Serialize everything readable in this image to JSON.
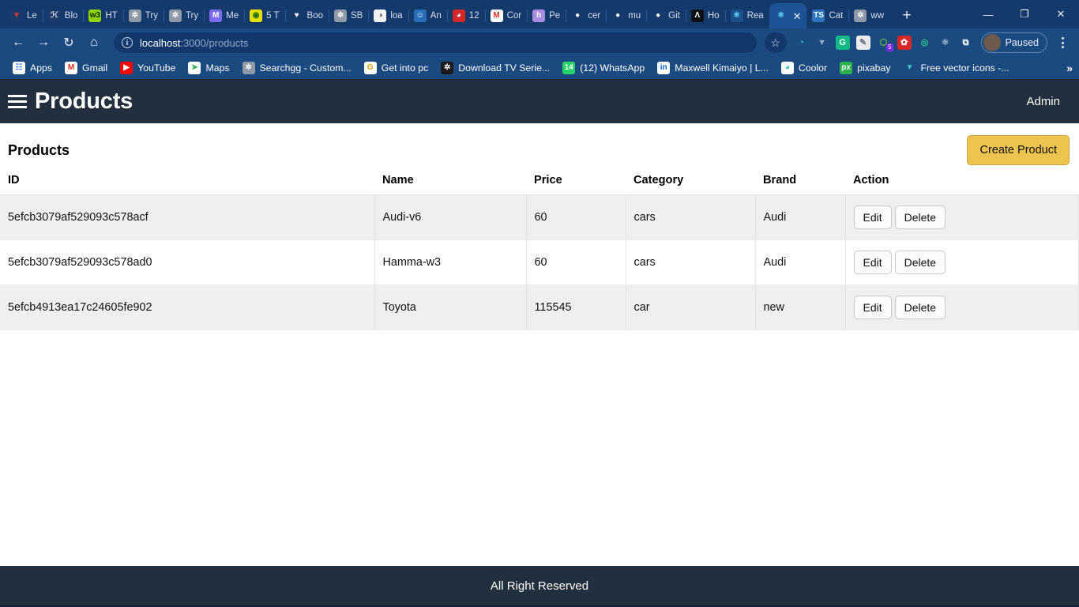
{
  "browser": {
    "tabs": [
      {
        "label": "Le",
        "icon": "vimeo-icon",
        "bg": "#1a3a6b",
        "fg": "#e3352b",
        "glyph": "▼",
        "active": false
      },
      {
        "label": "Blo",
        "icon": "handwriting-icon",
        "bg": "#1a3a6b",
        "fg": "#d8dde6",
        "glyph": "ℋ",
        "active": false
      },
      {
        "label": "HT",
        "icon": "w3schools-icon",
        "bg": "#8fd400",
        "fg": "#0b2a00",
        "glyph": "w3",
        "active": false
      },
      {
        "label": "Try",
        "icon": "globe-icon",
        "bg": "#8e9aa8",
        "fg": "#ffffff",
        "glyph": "✲",
        "active": false
      },
      {
        "label": "Try",
        "icon": "globe-icon",
        "bg": "#8e9aa8",
        "fg": "#ffffff",
        "glyph": "✲",
        "active": false
      },
      {
        "label": "Me",
        "icon": "messenger-icon",
        "bg": "#7b6cf0",
        "fg": "#ffffff",
        "glyph": "M",
        "active": false
      },
      {
        "label": "5 T",
        "icon": "frog-icon",
        "bg": "#e8e000",
        "fg": "#1b6f1b",
        "glyph": "◉",
        "active": false
      },
      {
        "label": "Boo",
        "icon": "heart-icon",
        "bg": "#14396b",
        "fg": "#ffffff",
        "glyph": "♥",
        "active": false
      },
      {
        "label": "SB",
        "icon": "globe-icon",
        "bg": "#8e9aa8",
        "fg": "#ffffff",
        "glyph": "✲",
        "active": false
      },
      {
        "label": "loa",
        "icon": "moon-icon",
        "bg": "#f2f2f2",
        "fg": "#555555",
        "glyph": "◑",
        "active": false
      },
      {
        "label": "An",
        "icon": "person-icon",
        "bg": "#2b6fb8",
        "fg": "#ffffff",
        "glyph": "☺",
        "active": false
      },
      {
        "label": "12",
        "icon": "pac-icon",
        "bg": "#d62828",
        "fg": "#ffffff",
        "glyph": "◕",
        "active": false
      },
      {
        "label": "Cor",
        "icon": "gmail-icon",
        "bg": "#ffffff",
        "fg": "#d93025",
        "glyph": "M",
        "active": false
      },
      {
        "label": "Pe",
        "icon": "heroku-icon",
        "bg": "#a88de0",
        "fg": "#ffffff",
        "glyph": "h",
        "active": false
      },
      {
        "label": "cer",
        "icon": "github-icon",
        "bg": "#14396b",
        "fg": "#ffffff",
        "glyph": "●",
        "active": false
      },
      {
        "label": "mu",
        "icon": "github-icon",
        "bg": "#14396b",
        "fg": "#ffffff",
        "glyph": "●",
        "active": false
      },
      {
        "label": "Git",
        "icon": "github-icon",
        "bg": "#14396b",
        "fg": "#ffffff",
        "glyph": "●",
        "active": false
      },
      {
        "label": "Ho",
        "icon": "brand-a-icon",
        "bg": "#0d1117",
        "fg": "#ffffff",
        "glyph": "Λ",
        "active": false
      },
      {
        "label": "Rea",
        "icon": "react-icon",
        "bg": "#1d4f8a",
        "fg": "#61dafb",
        "glyph": "⚛",
        "active": false
      },
      {
        "label": "",
        "icon": "react-icon",
        "bg": "#1d5294",
        "fg": "#61dafb",
        "glyph": "⚛",
        "active": true
      },
      {
        "label": "Cat",
        "icon": "typescript-icon",
        "bg": "#2f74c0",
        "fg": "#ffffff",
        "glyph": "TS",
        "active": false
      },
      {
        "label": "ww",
        "icon": "globe-icon",
        "bg": "#8e9aa8",
        "fg": "#ffffff",
        "glyph": "✲",
        "active": false
      }
    ],
    "new_tab_label": "+",
    "window_controls": {
      "minimize": "—",
      "maximize": "❐",
      "close": "✕"
    },
    "nav": {
      "back": "←",
      "forward": "→",
      "reload": "↻",
      "home": "⌂"
    },
    "address": {
      "scheme_icon": "info-icon",
      "host": "localhost",
      "path": ":3000/products"
    },
    "bookmark_star": "☆",
    "extensions": [
      {
        "name": "paint-extension-icon",
        "bg": "#1b4a80",
        "fg": "#35c6e0",
        "glyph": "◔"
      },
      {
        "name": "vimeo-extension-icon",
        "bg": "#1b4a80",
        "fg": "#8fa7c6",
        "glyph": "▼"
      },
      {
        "name": "grammarly-extension-icon",
        "bg": "#12b886",
        "fg": "#ffffff",
        "glyph": "G"
      },
      {
        "name": "clipboard-extension-icon",
        "bg": "#e9ecef",
        "fg": "#6c757d",
        "glyph": "✎"
      },
      {
        "name": "node-extension-icon",
        "bg": "#1b4a80",
        "fg": "#6fbf4a",
        "glyph": "⬡",
        "badge": "5"
      },
      {
        "name": "bug-extension-icon",
        "bg": "#d62828",
        "fg": "#ffffff",
        "glyph": "✿"
      },
      {
        "name": "target-extension-icon",
        "bg": "#1b4a80",
        "fg": "#22c38a",
        "glyph": "◎"
      },
      {
        "name": "react-devtools-icon",
        "bg": "#1b4a80",
        "fg": "#9fb6cf",
        "glyph": "⚛"
      },
      {
        "name": "puzzle-extension-icon",
        "bg": "#1b4a80",
        "fg": "#ffffff",
        "glyph": "⧉"
      }
    ],
    "profile": {
      "status": "Paused"
    },
    "bookmarks": [
      {
        "label": "Apps",
        "icon": "apps-grid-icon",
        "bg": "#ffffff",
        "fg": "#4285f4",
        "glyph": "☷"
      },
      {
        "label": "Gmail",
        "icon": "gmail-icon",
        "bg": "#ffffff",
        "fg": "#d93025",
        "glyph": "M"
      },
      {
        "label": "YouTube",
        "icon": "youtube-icon",
        "bg": "#ff0000",
        "fg": "#ffffff",
        "glyph": "▶"
      },
      {
        "label": "Maps",
        "icon": "maps-icon",
        "bg": "#ffffff",
        "fg": "#34a853",
        "glyph": "➤"
      },
      {
        "label": "Searchgg - Custom...",
        "icon": "globe-icon",
        "bg": "#8e9aa8",
        "fg": "#ffffff",
        "glyph": "✲"
      },
      {
        "label": "Get into pc",
        "icon": "google-icon",
        "bg": "#ffffff",
        "fg": "#e8a000",
        "glyph": "G"
      },
      {
        "label": "Download TV Serie...",
        "icon": "dark-globe-icon",
        "bg": "#1a1a1a",
        "fg": "#ffffff",
        "glyph": "✲"
      },
      {
        "label": "(12) WhatsApp",
        "icon": "whatsapp-icon",
        "bg": "#25d366",
        "fg": "#ffffff",
        "glyph": "14"
      },
      {
        "label": "Maxwell Kimaiyo | L...",
        "icon": "linkedin-icon",
        "bg": "#ffffff",
        "fg": "#0a66c2",
        "glyph": "in"
      },
      {
        "label": "Coolor",
        "icon": "coolors-icon",
        "bg": "#ffffff",
        "fg": "#2ec4b6",
        "glyph": "◕"
      },
      {
        "label": "pixabay",
        "icon": "pixabay-icon",
        "bg": "#2bb24c",
        "fg": "#ffffff",
        "glyph": "px"
      },
      {
        "label": "Free vector icons -...",
        "icon": "flaticon-icon",
        "bg": "#1b4a80",
        "fg": "#3ec6c6",
        "glyph": "▼"
      }
    ],
    "bookmarks_overflow": "»"
  },
  "app": {
    "navbar": {
      "menu_icon": "hamburger-menu-icon",
      "brand": "Products",
      "user": "Admin"
    },
    "page_title": "Products",
    "create_button": "Create Product",
    "table": {
      "columns": [
        "ID",
        "Name",
        "Price",
        "Category",
        "Brand",
        "Action"
      ],
      "rows": [
        {
          "id": "5efcb3079af529093c578acf",
          "name": "Audi-v6",
          "price": "60",
          "category": "cars",
          "brand": "Audi",
          "edit": "Edit",
          "delete": "Delete"
        },
        {
          "id": "5efcb3079af529093c578ad0",
          "name": "Hamma-w3",
          "price": "60",
          "category": "cars",
          "brand": "Audi",
          "edit": "Edit",
          "delete": "Delete"
        },
        {
          "id": "5efcb4913ea17c24605fe902",
          "name": "Toyota",
          "price": "115545",
          "category": "car",
          "brand": "new",
          "edit": "Edit",
          "delete": "Delete"
        }
      ]
    },
    "footer": "All Right Reserved"
  },
  "colors": {
    "navbar_bg": "#222f3e",
    "create_btn": "#edc450",
    "browser_chrome": "#1b4a80",
    "tabstrip": "#14396b",
    "row_stripe": "#efefef"
  }
}
